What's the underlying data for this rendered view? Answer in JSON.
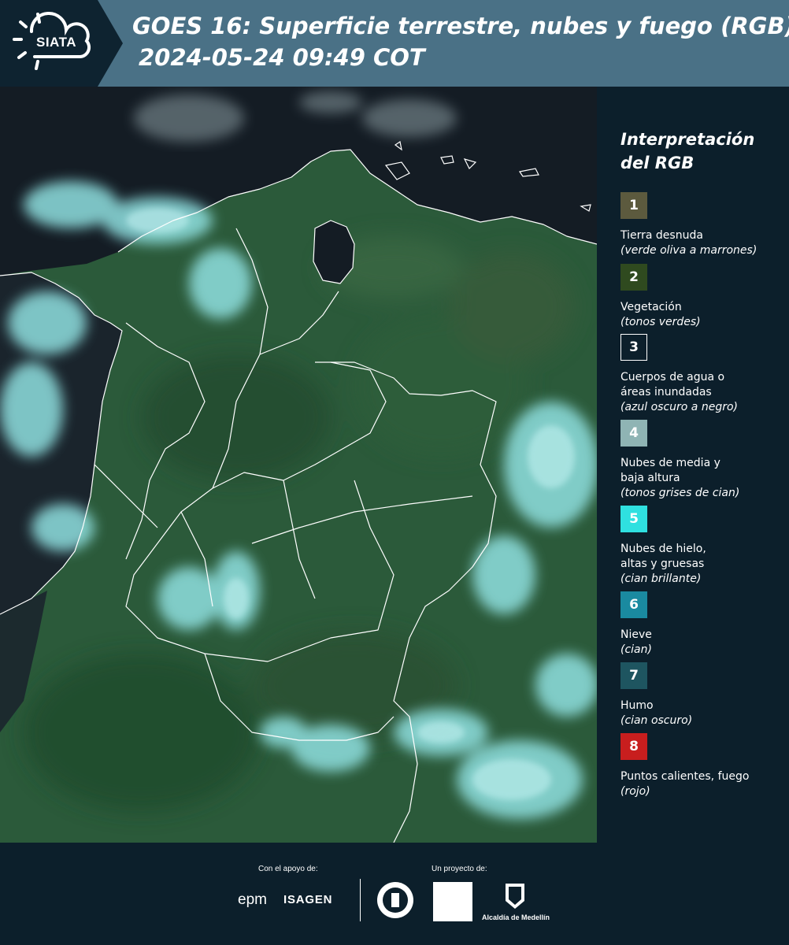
{
  "header": {
    "logo_text": "SIATA",
    "title": "GOES 16: Superficie terrestre, nubes y fuego (RGB)",
    "subtitle": "2024-05-24 09:49 COT"
  },
  "map": {
    "colors": {
      "land": "#2b5a3a",
      "ocean": "#141c24",
      "cloud": "#8fe0e0",
      "border": "#ffffff"
    }
  },
  "legend": {
    "title": "Interpretación del RGB",
    "items": [
      {
        "number": "1",
        "label": "Tierra desnuda",
        "note": "(verde oliva a marrones)",
        "color": "#5c5a3e"
      },
      {
        "number": "2",
        "label": "Vegetación",
        "note": "(tonos verdes)",
        "color": "#2f4a1f"
      },
      {
        "number": "3",
        "label": "Cuerpos de agua o\náreas inundadas",
        "note": "(azul oscuro a negro)",
        "color": "#0c1f2b"
      },
      {
        "number": "4",
        "label": "Nubes de media y\nbaja altura",
        "note": "(tonos grises de cian)",
        "color": "#8fb4b4"
      },
      {
        "number": "5",
        "label": "Nubes de hielo,\naltas y gruesas",
        "note": "(cian brillante)",
        "color": "#2fe0e0"
      },
      {
        "number": "6",
        "label": "Nieve",
        "note": "(cian)",
        "color": "#1a8aa0"
      },
      {
        "number": "7",
        "label": "Humo",
        "note": "(cian oscuro)",
        "color": "#1e5560"
      },
      {
        "number": "8",
        "label": "Puntos calientes, fuego",
        "note": "(rojo)",
        "color": "#c81e1e"
      }
    ]
  },
  "footer": {
    "support_label": "Con el apoyo de:",
    "project_label": "Un proyecto de:",
    "sponsors": [
      "epm",
      "ISAGEN"
    ],
    "partner_text": "Alcaldía de Medellín"
  }
}
